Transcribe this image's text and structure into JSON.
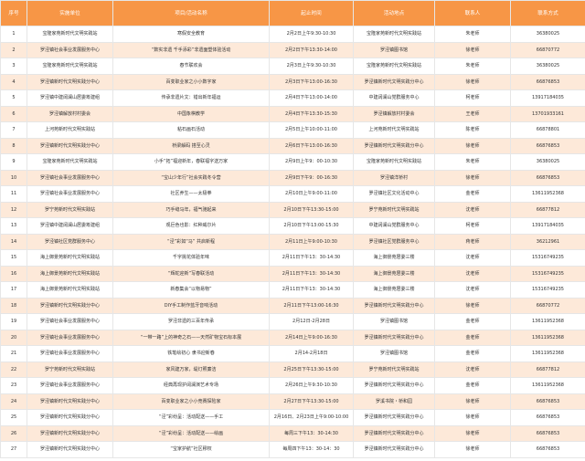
{
  "table": {
    "headers": [
      "序号",
      "实施单位",
      "项目/活动名称",
      "起止时间",
      "活动地点",
      "联系人",
      "联系方式"
    ],
    "rows": [
      [
        "1",
        "宝隆家苑新时代文明实践站",
        "寒假安全教育",
        "2月2日上午9:30-10:30",
        "宝隆家苑新时代文明实践站",
        "朱老师",
        "36380025"
      ],
      [
        "2",
        "罗泾镇社会事业发展服务中心",
        "“数实非遗 千手添彩”非遗面塑体验活动",
        "2月2日下午13:30-14:00",
        "罗泾镇图书馆",
        "徐老师",
        "66870772"
      ],
      [
        "3",
        "宝隆家苑新时代文明实践站",
        "春节联欢会",
        "2月3日上午9:30-10:30",
        "宝隆家苑新时代文明实践站",
        "朱老师",
        "36380025"
      ],
      [
        "4",
        "罗泾镇新时代文明实践分中心",
        "百变职业家之小小数字家",
        "2月3日下午13:00-16:30",
        "罗泾镇新时代文明实践分中心",
        "徐老师",
        "66876853"
      ],
      [
        "5",
        "罗泾镇中建阔澜山居委筹建组",
        "传承非遗片文：错出新年福运",
        "2月4日下午13:00-14:00",
        "中建阔澜山党群服务中心",
        "柯老师",
        "13917184035"
      ],
      [
        "6",
        "罗泾镇解放村村委会",
        "中国象棋教学",
        "2月4日下午13:30-15:30",
        "罗泾镇解放村村委会",
        "王老师",
        "13701933161"
      ],
      [
        "7",
        "上河苑新时代文明实践站",
        "粘石画石活动",
        "2月5日上午10:00-11:00",
        "上河苑新时代文明实践站",
        "陈老师",
        "66878801"
      ],
      [
        "8",
        "罗泾镇新时代文明实践分中心",
        "桥梁解码 搭至心灵",
        "2月6日下午13:00-16:30",
        "罗泾镇新时代文明实践分中心",
        "徐老师",
        "66876853"
      ],
      [
        "9",
        "宝隆家苑新时代文明实践站",
        "小手“拓”福迎新年，春联福字送万家",
        "2月9日上午9：00-10:30",
        "宝隆家苑新时代文明实践站",
        "朱老师",
        "36380025"
      ],
      [
        "10",
        "罗泾镇社会事业发展服务中心",
        "“宝山少年行”社会实践冬令营",
        "2月9日下午9：00-16:30",
        "罗泾镇洋桥村",
        "徐老师",
        "66876853"
      ],
      [
        "11",
        "罗泾镇社会事业发展服务中心",
        "社区养生——太极拳",
        "2月10日上午9:00-11:00",
        "罗泾镇社区文化活动中心",
        "金老师",
        "13611952368"
      ],
      [
        "12",
        "罗宁苑新时代文明实践站",
        "巧手缝马年，福气驰起来",
        "2月10日下午13:30-15:00",
        "罗宁苑新时代文明实践站",
        "沈老师",
        "66877812"
      ],
      [
        "13",
        "罗泾镇中建阔澜山居委筹建组",
        "观巨色也影：红种威尔片",
        "2月10日下午13:00-15:30",
        "中建阔澜山党群服务中心",
        "柯老师",
        "13917184035"
      ],
      [
        "14",
        "罗泾镇社区党群服务中心",
        "“泾”彩如“马” 共启新程",
        "2月11日上午9:00-10:30",
        "罗泾镇社区党群服务中心",
        "蒋老师",
        "36212961"
      ],
      [
        "15",
        "海上御景苑新时代文明实践站",
        "千字挑花体验年味",
        "2月11日下午13：30-14:30",
        "海上御景苑居委三楼",
        "沈老师",
        "15316749235"
      ],
      [
        "16",
        "海上御景苑新时代文明实践站",
        "“辉蛇迎新”写春联活动",
        "2月11日下午13：30-14:30",
        "海上御景苑居委三楼",
        "沈老师",
        "15316749235"
      ],
      [
        "17",
        "海上御景苑新时代文明实践站",
        "新春集会“以物易物”",
        "2月11日下午13：30-14:30",
        "海上御景苑居委三楼",
        "沈老师",
        "15316749235"
      ],
      [
        "18",
        "罗泾镇新时代文明实践分中心",
        "DIY手工制作蓝牙音响活动",
        "2月11日下午13:00-16:30",
        "罗泾镇新时代文明实践分中心",
        "徐老师",
        "66870772"
      ],
      [
        "19",
        "罗泾镇社会事业发展服务中心",
        "罗泾非遗的三百年传承",
        "2月12日-2月28日",
        "罗泾镇图书馆",
        "金老师",
        "13611952368"
      ],
      [
        "20",
        "罗泾镇社会事业发展服务中心",
        "“一带一路”上的神奇之石——天然矿物宝石标本展",
        "2月14日上午9:00-16:30",
        "罗泾镇新时代文明实践分中心",
        "金老师",
        "13611952368"
      ],
      [
        "21",
        "罗泾镇社会事业发展服务中心",
        "铁笔绘初心 隶书迎新春",
        "2月14-2月18日",
        "罗泾镇图书馆",
        "金老师",
        "13611952368"
      ],
      [
        "22",
        "罗宁苑新时代文明实践站",
        "家风建万家，堤灯照廉洁",
        "2月25日下午13:30-15:00",
        "罗宁苑新时代文明实践站",
        "沈老师",
        "66877812"
      ],
      [
        "23",
        "罗泾镇社会事业发展服务中心",
        "经典再现护阔澜演艺术专场",
        "2月26日上午9:30-10:30",
        "罗泾镇新时代文明实践分中心",
        "金老师",
        "13611952368"
      ],
      [
        "24",
        "罗泾镇新时代文明实践分中心",
        "百变职业家之小小竞赛探险家",
        "2月27日下午13:30-15:00",
        "罗溪书院・桥和园",
        "徐老师",
        "66876853"
      ],
      [
        "25",
        "罗泾镇新时代文明实践分中心",
        "“泾”彩纷呈：活动配送——手工",
        "2月16日、2月23日上午9:00-10:00",
        "罗泾镇新时代文明实践分中心",
        "徐老师",
        "66876853"
      ],
      [
        "26",
        "罗泾镇新时代文明实践分中心",
        "“泾”彩纷呈：活动配送——绘画",
        "每周三下午13：30-14:30",
        "罗泾镇新时代文明实践分中心",
        "徐老师",
        "66876853"
      ],
      [
        "27",
        "罗泾镇新时代文明实践分中心",
        "“宝家护航”社区穆权",
        "每周四下午13：30-14：30",
        "罗泾镇新时代文明实践分中心",
        "徐老师",
        "66876853"
      ]
    ]
  }
}
